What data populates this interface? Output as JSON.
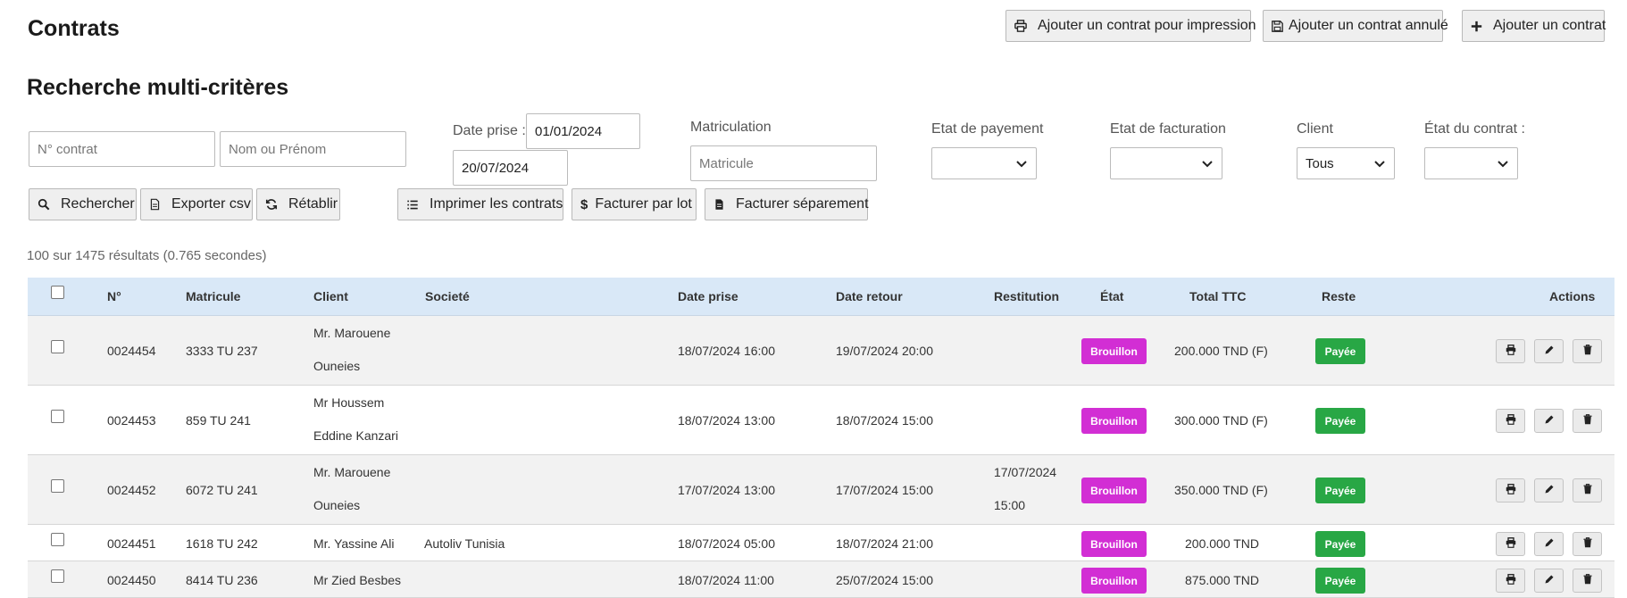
{
  "page_title": "Contrats",
  "top_buttons": {
    "print": "Ajouter un contrat pour impression",
    "cancelled": "Ajouter un contrat annulé",
    "add": "Ajouter un contrat"
  },
  "search": {
    "title": "Recherche multi-critères",
    "contract_placeholder": "N° contrat",
    "name_placeholder": "Nom ou Prénom",
    "date_label": "Date prise :",
    "date_from": "01/01/2024",
    "date_to": "20/07/2024",
    "plate_label": "Matriculation",
    "plate_placeholder": "Matricule",
    "payment_label": "Etat de payement",
    "payment_value": "",
    "billing_label": "Etat de facturation",
    "billing_value": "",
    "client_label": "Client",
    "client_value": "Tous",
    "status_label": "État du contrat :",
    "status_value": ""
  },
  "actions": {
    "search": "Rechercher",
    "export": "Exporter csv",
    "reset": "Rétablir",
    "print_all": "Imprimer les contrats",
    "bill_batch": "Facturer par lot",
    "bill_separate": "Facturer séparement"
  },
  "results_text": "100 sur 1475 résultats (0.765 secondes)",
  "table": {
    "headers": {
      "num": "N°",
      "plate": "Matricule",
      "client": "Client",
      "company": "Societé",
      "date_out": "Date prise",
      "date_back": "Date retour",
      "restitution": "Restitution",
      "state": "État",
      "total": "Total TTC",
      "rest": "Reste",
      "actions": "Actions"
    },
    "rows": [
      {
        "num": "0024454",
        "plate": "3333 TU 237",
        "client1": "Mr. Marouene",
        "client2": "Ouneies",
        "company": "",
        "date_out": "18/07/2024 16:00",
        "date_back": "19/07/2024 20:00",
        "rest1": "",
        "rest2": "",
        "state": "Brouillon",
        "total": "200.000 TND (F)",
        "reste": "Payée"
      },
      {
        "num": "0024453",
        "plate": "859 TU 241",
        "client1": "Mr Houssem",
        "client2": "Eddine Kanzari",
        "company": "",
        "date_out": "18/07/2024 13:00",
        "date_back": "18/07/2024 15:00",
        "rest1": "",
        "rest2": "",
        "state": "Brouillon",
        "total": "300.000 TND (F)",
        "reste": "Payée"
      },
      {
        "num": "0024452",
        "plate": "6072 TU 241",
        "client1": "Mr. Marouene",
        "client2": "Ouneies",
        "company": "",
        "date_out": "17/07/2024 13:00",
        "date_back": "17/07/2024 15:00",
        "rest1": "17/07/2024",
        "rest2": "15:00",
        "state": "Brouillon",
        "total": "350.000 TND (F)",
        "reste": "Payée"
      },
      {
        "num": "0024451",
        "plate": "1618 TU 242",
        "client1": "Mr. Yassine Ali",
        "client2": "",
        "company": "Autoliv Tunisia",
        "date_out": "18/07/2024 05:00",
        "date_back": "18/07/2024 21:00",
        "rest1": "",
        "rest2": "",
        "state": "Brouillon",
        "total": "200.000 TND",
        "reste": "Payée"
      },
      {
        "num": "0024450",
        "plate": "8414 TU 236",
        "client1": "Mr Zied Besbes",
        "client2": "",
        "company": "",
        "date_out": "18/07/2024 11:00",
        "date_back": "25/07/2024 15:00",
        "rest1": "",
        "rest2": "",
        "state": "Brouillon",
        "total": "875.000 TND",
        "reste": "Payée"
      }
    ]
  },
  "colors": {
    "header_bg": "#d9e8f7",
    "draft_badge": "#d22ed4",
    "paid_badge": "#28a745"
  }
}
